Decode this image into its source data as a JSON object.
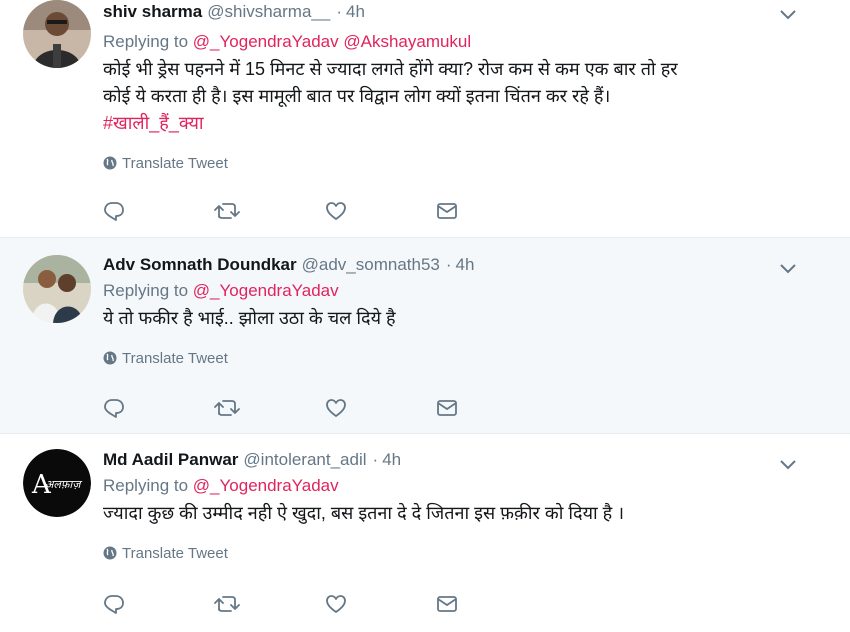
{
  "tweets": [
    {
      "fullname": "shiv sharma",
      "username": "@shivsharma__",
      "dot": "·",
      "time": "4h",
      "replying_to": "Replying to",
      "mentions": [
        "@_YogendraYadav",
        "@Akshayamukul"
      ],
      "text_lines": [
        "कोई भी ड्रेस पहनने में 15 मिनट से ज्यादा लगते होंगे क्या? रोज कम से कम एक बार तो हर",
        "कोई ये करता ही है। इस मामूली बात पर विद्वान लोग क्यों इतना चिंतन कर रहे हैं।"
      ],
      "hashtag": "#खाली_हैं_क्या",
      "translate": "Translate Tweet"
    },
    {
      "fullname": "Adv Somnath Doundkar",
      "username": "@adv_somnath53",
      "dot": "·",
      "time": "4h",
      "replying_to": "Replying to",
      "mentions": [
        "@_YogendraYadav"
      ],
      "text_lines": [
        "ये तो फकीर है भाई.. झोला उठा के चल दिये है"
      ],
      "translate": "Translate Tweet"
    },
    {
      "fullname": "Md Aadil Panwar",
      "username": "@intolerant_adil",
      "dot": "·",
      "time": "4h",
      "replying_to": "Replying to",
      "mentions": [
        "@_YogendraYadav"
      ],
      "text_lines": [
        "ज्यादा कुछ की उम्मीद नही ऐ खुदा, बस इतना दे दे जितना इस फ़क़ीर को दिया है ।"
      ],
      "translate": "Translate Tweet",
      "avatar_text": "अलफ़ाज़"
    }
  ],
  "icons": {
    "reply": "reply-icon",
    "retweet": "retweet-icon",
    "like": "heart-icon",
    "dm": "envelope-icon",
    "caret": "chevron-down-icon",
    "globe": "globe-icon"
  },
  "colors": {
    "mention": "#e0245e",
    "muted": "#657786",
    "highlight_bg": "#f5f8fa",
    "divider": "#e6ecf0"
  }
}
